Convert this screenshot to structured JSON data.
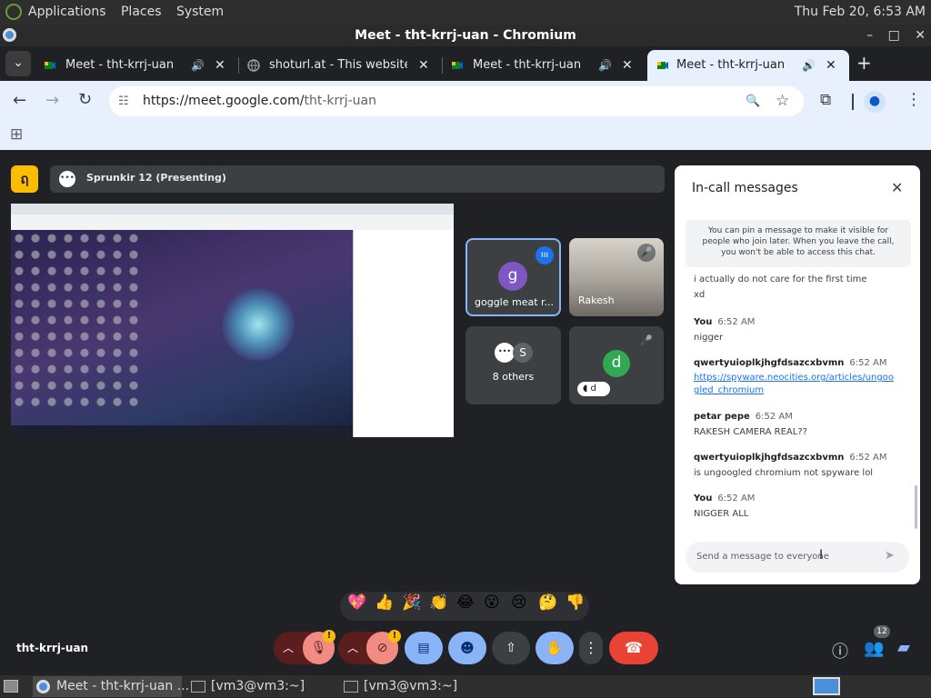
{
  "topbar": {
    "menus": [
      "Applications",
      "Places",
      "System"
    ],
    "clock": "Thu Feb 20, 6:53 AM"
  },
  "window": {
    "title": "Meet - tht-krrj-uan - Chromium",
    "controls": [
      "–",
      "□",
      "✕"
    ]
  },
  "tabs": [
    {
      "label": "Meet - tht-krrj-uan"
    },
    {
      "label": "shoturl.at - This website is"
    },
    {
      "label": "Meet - tht-krrj-uan"
    },
    {
      "label": "Meet - tht-krrj-uan"
    }
  ],
  "tab_icons": {
    "dropdown": "⌄",
    "sound": "🔊",
    "close": "✕",
    "new": "+"
  },
  "omnibox": {
    "url_host": "https://meet.google.com/",
    "url_path": "tht-krrj-uan"
  },
  "nav_icons": {
    "back": "←",
    "forward": "→",
    "reload": "↻",
    "zoom": "🔍",
    "star": "☆",
    "ext": "⧉",
    "menu": "⋮",
    "apps": "⊞"
  },
  "meet": {
    "presenting": "Sprunkir 12 (Presenting)",
    "tiles": [
      {
        "initial": "g",
        "name": "goggle meat r..."
      },
      {
        "name": "Rakesh"
      },
      {
        "initial": "S",
        "label": "8 others"
      },
      {
        "initial": "d",
        "tag": "d"
      }
    ],
    "meeting_code": "tht-krrj-uan",
    "people_count": "12",
    "reactions": [
      "💖",
      "👍",
      "🎉",
      "👏",
      "😂",
      "😮",
      "😢",
      "🤔",
      "👎"
    ],
    "warning": "!"
  },
  "chat": {
    "title": "In-call messages",
    "close": "✕",
    "pin_note": "You can pin a message to make it visible for people who join later. When you leave the call, you won't be able to access this chat.",
    "messages": [
      {
        "sender": "",
        "time": "",
        "lines": [
          "i actually do not care for the first time",
          "xd"
        ]
      },
      {
        "sender": "You",
        "time": "6:52 AM",
        "lines": [
          "nigger"
        ]
      },
      {
        "sender": "qwertyuioplkjhgfdsazcxbvmn",
        "time": "6:52 AM",
        "link": "https://spyware.neocities.org/articles/ungoogled_chromium"
      },
      {
        "sender": "petar pepe",
        "time": "6:52 AM",
        "lines": [
          "RAKESH CAMERA REAL??"
        ]
      },
      {
        "sender": "qwertyuioplkjhgfdsazcxbvmn",
        "time": "6:52 AM",
        "lines": [
          "is ungoogled chromium not spyware lol"
        ]
      },
      {
        "sender": "You",
        "time": "6:52 AM",
        "lines": [
          "NIGGER ALL"
        ]
      }
    ],
    "input_placeholder": "Send a message to everyone",
    "send": "➤"
  },
  "taskbar": {
    "items": [
      "Meet - tht-krrj-uan ...",
      "[vm3@vm3:~]",
      "[vm3@vm3:~]"
    ]
  }
}
